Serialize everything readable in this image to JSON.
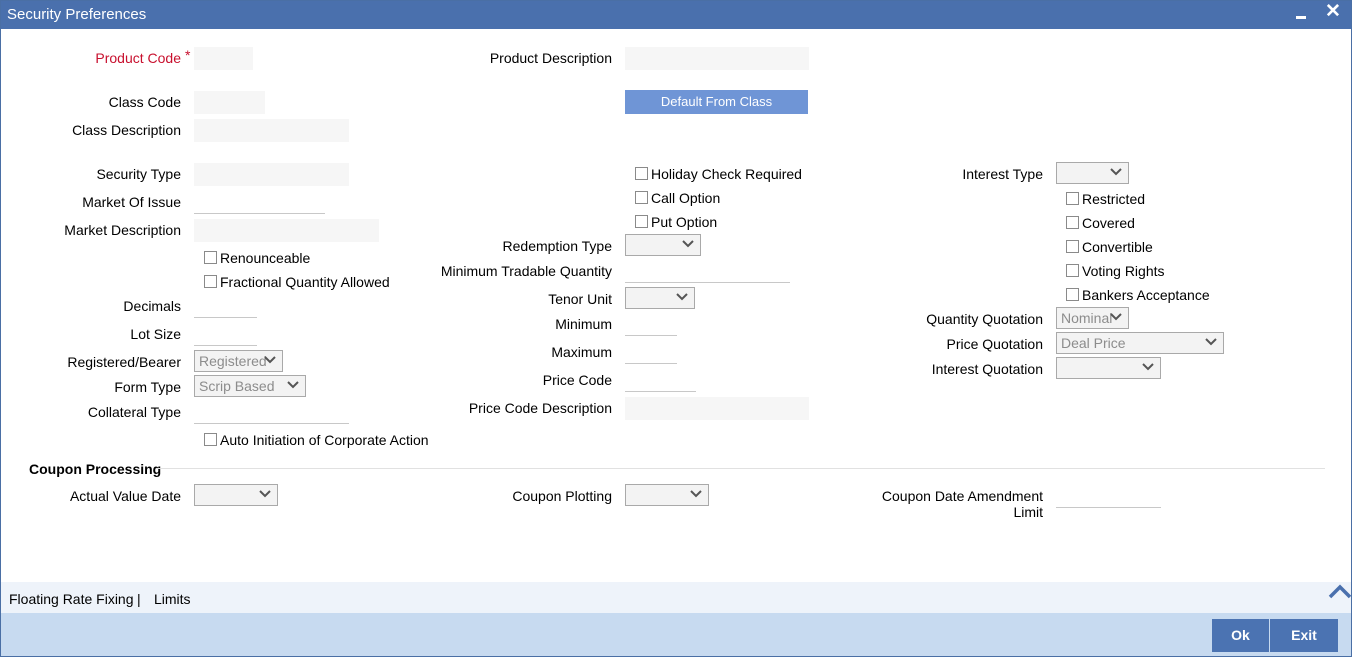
{
  "window": {
    "title": "Security Preferences"
  },
  "fields": {
    "product_code": {
      "label": "Product Code",
      "required_mark": "*",
      "value": ""
    },
    "product_description": {
      "label": "Product Description",
      "value": ""
    },
    "class_code": {
      "label": "Class Code",
      "value": ""
    },
    "default_from_class": {
      "label": "Default From Class"
    },
    "class_description": {
      "label": "Class Description",
      "value": ""
    },
    "security_type": {
      "label": "Security Type",
      "value": ""
    },
    "market_of_issue": {
      "label": "Market Of Issue",
      "value": ""
    },
    "market_description": {
      "label": "Market Description",
      "value": ""
    },
    "renounceable": {
      "label": "Renounceable",
      "checked": false
    },
    "fractional_quantity_allowed": {
      "label": "Fractional Quantity Allowed",
      "checked": false
    },
    "decimals": {
      "label": "Decimals",
      "value": ""
    },
    "lot_size": {
      "label": "Lot Size",
      "value": ""
    },
    "registered_bearer": {
      "label": "Registered/Bearer",
      "value": "Registered"
    },
    "form_type": {
      "label": "Form Type",
      "value": "Scrip Based"
    },
    "collateral_type": {
      "label": "Collateral Type",
      "value": ""
    },
    "auto_initiation": {
      "label": "Auto Initiation of Corporate Action",
      "checked": false
    },
    "holiday_check_required": {
      "label": "Holiday Check Required",
      "checked": false
    },
    "call_option": {
      "label": "Call Option",
      "checked": false
    },
    "put_option": {
      "label": "Put Option",
      "checked": false
    },
    "redemption_type": {
      "label": "Redemption Type",
      "value": ""
    },
    "minimum_tradable_quantity": {
      "label": "Minimum Tradable Quantity",
      "value": ""
    },
    "tenor_unit": {
      "label": "Tenor Unit",
      "value": ""
    },
    "minimum": {
      "label": "Minimum",
      "value": ""
    },
    "maximum": {
      "label": "Maximum",
      "value": ""
    },
    "price_code": {
      "label": "Price Code",
      "value": ""
    },
    "price_code_description": {
      "label": "Price Code Description",
      "value": ""
    },
    "interest_type": {
      "label": "Interest Type",
      "value": ""
    },
    "restricted": {
      "label": "Restricted",
      "checked": false
    },
    "covered": {
      "label": "Covered",
      "checked": false
    },
    "convertible": {
      "label": "Convertible",
      "checked": false
    },
    "voting_rights": {
      "label": "Voting Rights",
      "checked": false
    },
    "bankers_acceptance": {
      "label": "Bankers Acceptance",
      "checked": false
    },
    "quantity_quotation": {
      "label": "Quantity Quotation",
      "value": "Nominal"
    },
    "price_quotation": {
      "label": "Price Quotation",
      "value": "Deal Price"
    },
    "interest_quotation": {
      "label": "Interest Quotation",
      "value": ""
    }
  },
  "coupon_processing": {
    "title": "Coupon Processing",
    "actual_value_date": {
      "label": "Actual Value Date",
      "value": ""
    },
    "coupon_plotting": {
      "label": "Coupon Plotting",
      "value": ""
    },
    "coupon_date_amendment_limit": {
      "label_line1": "Coupon Date Amendment",
      "label_line2": "Limit",
      "value": ""
    }
  },
  "footer": {
    "links": [
      "Floating Rate Fixing",
      "Limits"
    ],
    "separator": "|"
  },
  "buttons": {
    "ok": "Ok",
    "exit": "Exit"
  },
  "colors": {
    "titlebar": "#4a70ad",
    "required_label": "#c8102e",
    "default_button": "#6f95d6",
    "action_button": "#4b73b2",
    "bottom_bar": "#c7daf0"
  }
}
